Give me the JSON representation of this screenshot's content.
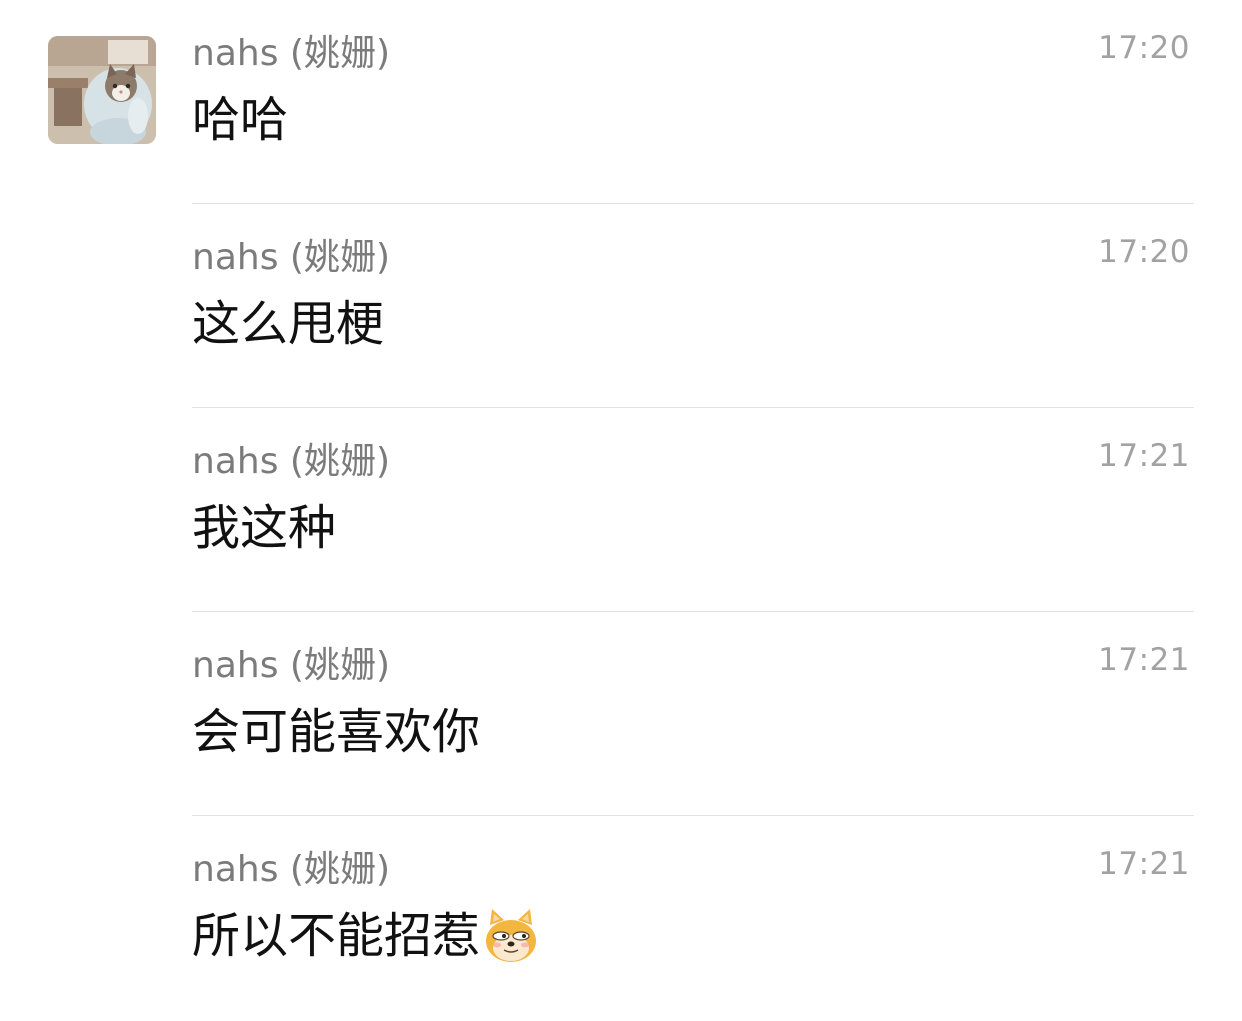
{
  "messages": [
    {
      "sender": "nahs (姚姗)",
      "time": "17:20",
      "text": "哈哈"
    },
    {
      "sender": "nahs (姚姗)",
      "time": "17:20",
      "text": "这么甩梗"
    },
    {
      "sender": "nahs (姚姗)",
      "time": "17:21",
      "text": "我这种"
    },
    {
      "sender": "nahs (姚姗)",
      "time": "17:21",
      "text": "会可能喜欢你"
    },
    {
      "sender": "nahs (姚姗)",
      "time": "17:21",
      "text": "所以不能招惹",
      "emoji": "doge-emoji"
    }
  ],
  "avatar": {
    "icon": "cat-avatar"
  }
}
